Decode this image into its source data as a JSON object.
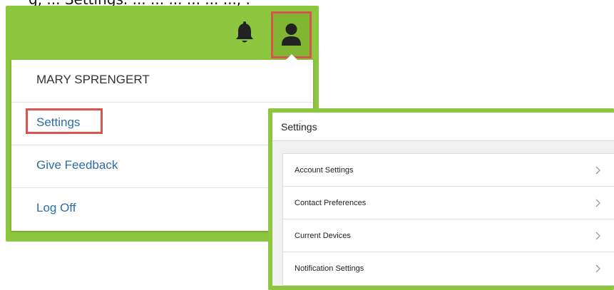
{
  "caption": "cropped line of body text from the source document",
  "header": {
    "bell_icon": "bell-icon",
    "user_icon": "user-icon",
    "accent_color": "#8dc63f",
    "highlight_color": "#d9534f"
  },
  "user_menu": {
    "user_name": "MARY SPRENGERT",
    "items": [
      {
        "label": "Settings",
        "highlighted": true
      },
      {
        "label": "Give Feedback",
        "highlighted": false
      },
      {
        "label": "Log Off",
        "highlighted": false
      }
    ],
    "link_color": "#2e6da4"
  },
  "settings_panel": {
    "title": "Settings",
    "items": [
      {
        "label": "Account Settings",
        "icon": "chevron-right-icon"
      },
      {
        "label": "Contact Preferences",
        "icon": "chevron-right-icon"
      },
      {
        "label": "Current Devices",
        "icon": "chevron-right-icon"
      },
      {
        "label": "Notification Settings",
        "icon": "chevron-right-icon"
      }
    ]
  }
}
